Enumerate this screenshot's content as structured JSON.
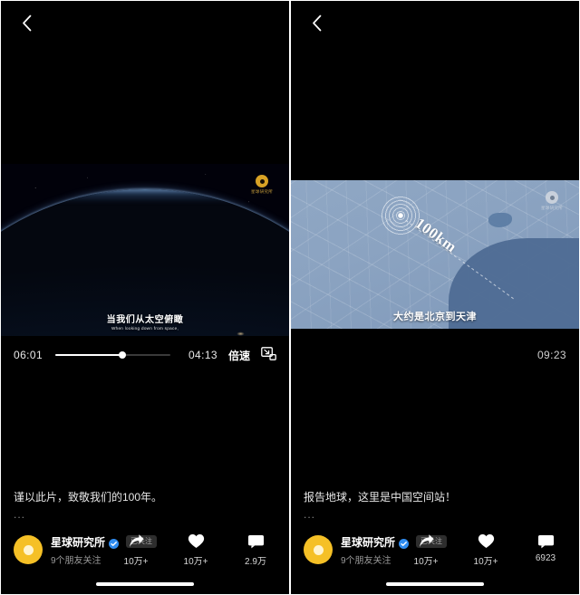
{
  "panels": [
    {
      "id": "video-post",
      "back_icon": "chevron-left-icon",
      "media": {
        "kind": "earth-night-photo",
        "watermark_text": "星球研究所",
        "watermark_icon": "planet-logo-icon",
        "subtitle_cn": "当我们从太空俯瞰",
        "subtitle_en": "When looking down from space,"
      },
      "player": {
        "current_time": "06:01",
        "remaining_time": "04:13",
        "progress_percent": 58,
        "speed_label": "倍速",
        "pip_icon": "picture-in-picture-icon"
      },
      "caption": {
        "text": "谨以此片，致敬我们的100年。",
        "more": "..."
      },
      "author": {
        "avatar_icon": "planet-avatar-icon",
        "name": "星球研究所",
        "verified_icon": "verified-badge-icon",
        "follow_label": "已关注",
        "friends_text": "9个朋友关注"
      },
      "actions": [
        {
          "icon": "share-arrow-icon",
          "count": "10万+"
        },
        {
          "icon": "heart-icon",
          "count": "10万+"
        },
        {
          "icon": "comment-bubble-icon",
          "count": "2.9万"
        }
      ]
    },
    {
      "id": "image-post",
      "back_icon": "chevron-left-icon",
      "media": {
        "kind": "map-distance-graphic",
        "watermark_text": "星球研究所",
        "watermark_icon": "planet-logo-icon",
        "distance_label": "100km",
        "map_caption": "大约是北京到天津"
      },
      "timestamp": "09:23",
      "caption": {
        "text": "报告地球，这里是中国空间站！",
        "more": "..."
      },
      "author": {
        "avatar_icon": "planet-avatar-icon",
        "name": "星球研究所",
        "verified_icon": "verified-badge-icon",
        "follow_label": "已关注",
        "friends_text": "9个朋友关注"
      },
      "actions": [
        {
          "icon": "share-arrow-icon",
          "count": "10万+"
        },
        {
          "icon": "heart-icon",
          "count": "10万+"
        },
        {
          "icon": "comment-bubble-icon",
          "count": "6923"
        }
      ]
    }
  ],
  "colors": {
    "background": "#000000",
    "accent_yellow": "#f5c026",
    "verified_blue": "#2f8cf0",
    "text_primary": "#ffffff",
    "text_secondary": "#9a9a9a",
    "map_land": "#8ba3c1",
    "map_sea": "#4e6c93"
  }
}
